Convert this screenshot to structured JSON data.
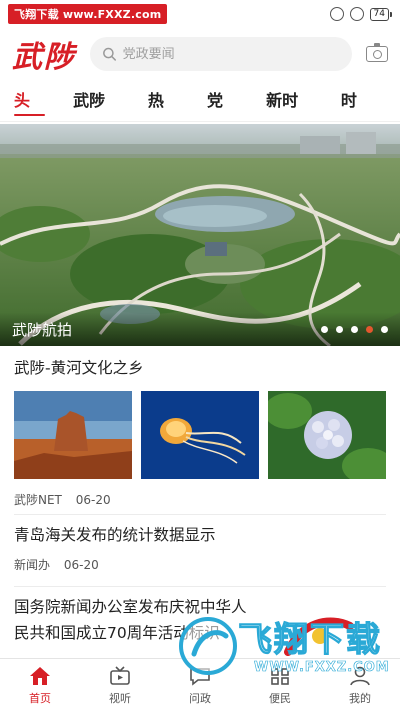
{
  "status_bar": {
    "watermark": "飞翔下载 www.FXXZ.com",
    "battery": "74"
  },
  "header": {
    "logo": "武陟",
    "search_placeholder": "党政要闻",
    "camera_icon": "camera-icon"
  },
  "tabs": [
    {
      "label": "头条",
      "active": true
    },
    {
      "label": "武陟号"
    },
    {
      "label": "热点"
    },
    {
      "label": "党建"
    },
    {
      "label": "新时代"
    },
    {
      "label": "时政"
    }
  ],
  "hero": {
    "caption": "武陟航拍",
    "slides": 5,
    "active_slide": 4
  },
  "articles": [
    {
      "title": "武陟-黄河文化之乡",
      "source": "武陟NET",
      "date": "06-20",
      "thumbnails": [
        "desert-butte-image",
        "jellyfish-image",
        "hydrangea-image"
      ]
    },
    {
      "title": "青岛海关发布的统计数据显示",
      "source": "新闻办",
      "date": "06-20"
    },
    {
      "title": "国务院新闻办公室发布庆祝中华人民共和国成立70周年活动标识"
    }
  ],
  "bottom_nav": [
    {
      "label": "首页",
      "icon": "home-icon",
      "active": true
    },
    {
      "label": "视听",
      "icon": "tv-icon"
    },
    {
      "label": "问政",
      "icon": "chat-icon"
    },
    {
      "label": "便民",
      "icon": "service-icon"
    },
    {
      "label": "我的",
      "icon": "user-icon"
    }
  ],
  "watermark": {
    "text": "飞翔下载",
    "url": "WWW.FXXZ.COM"
  },
  "colors": {
    "accent": "#d71f26",
    "slide_active": "#e4572e"
  }
}
